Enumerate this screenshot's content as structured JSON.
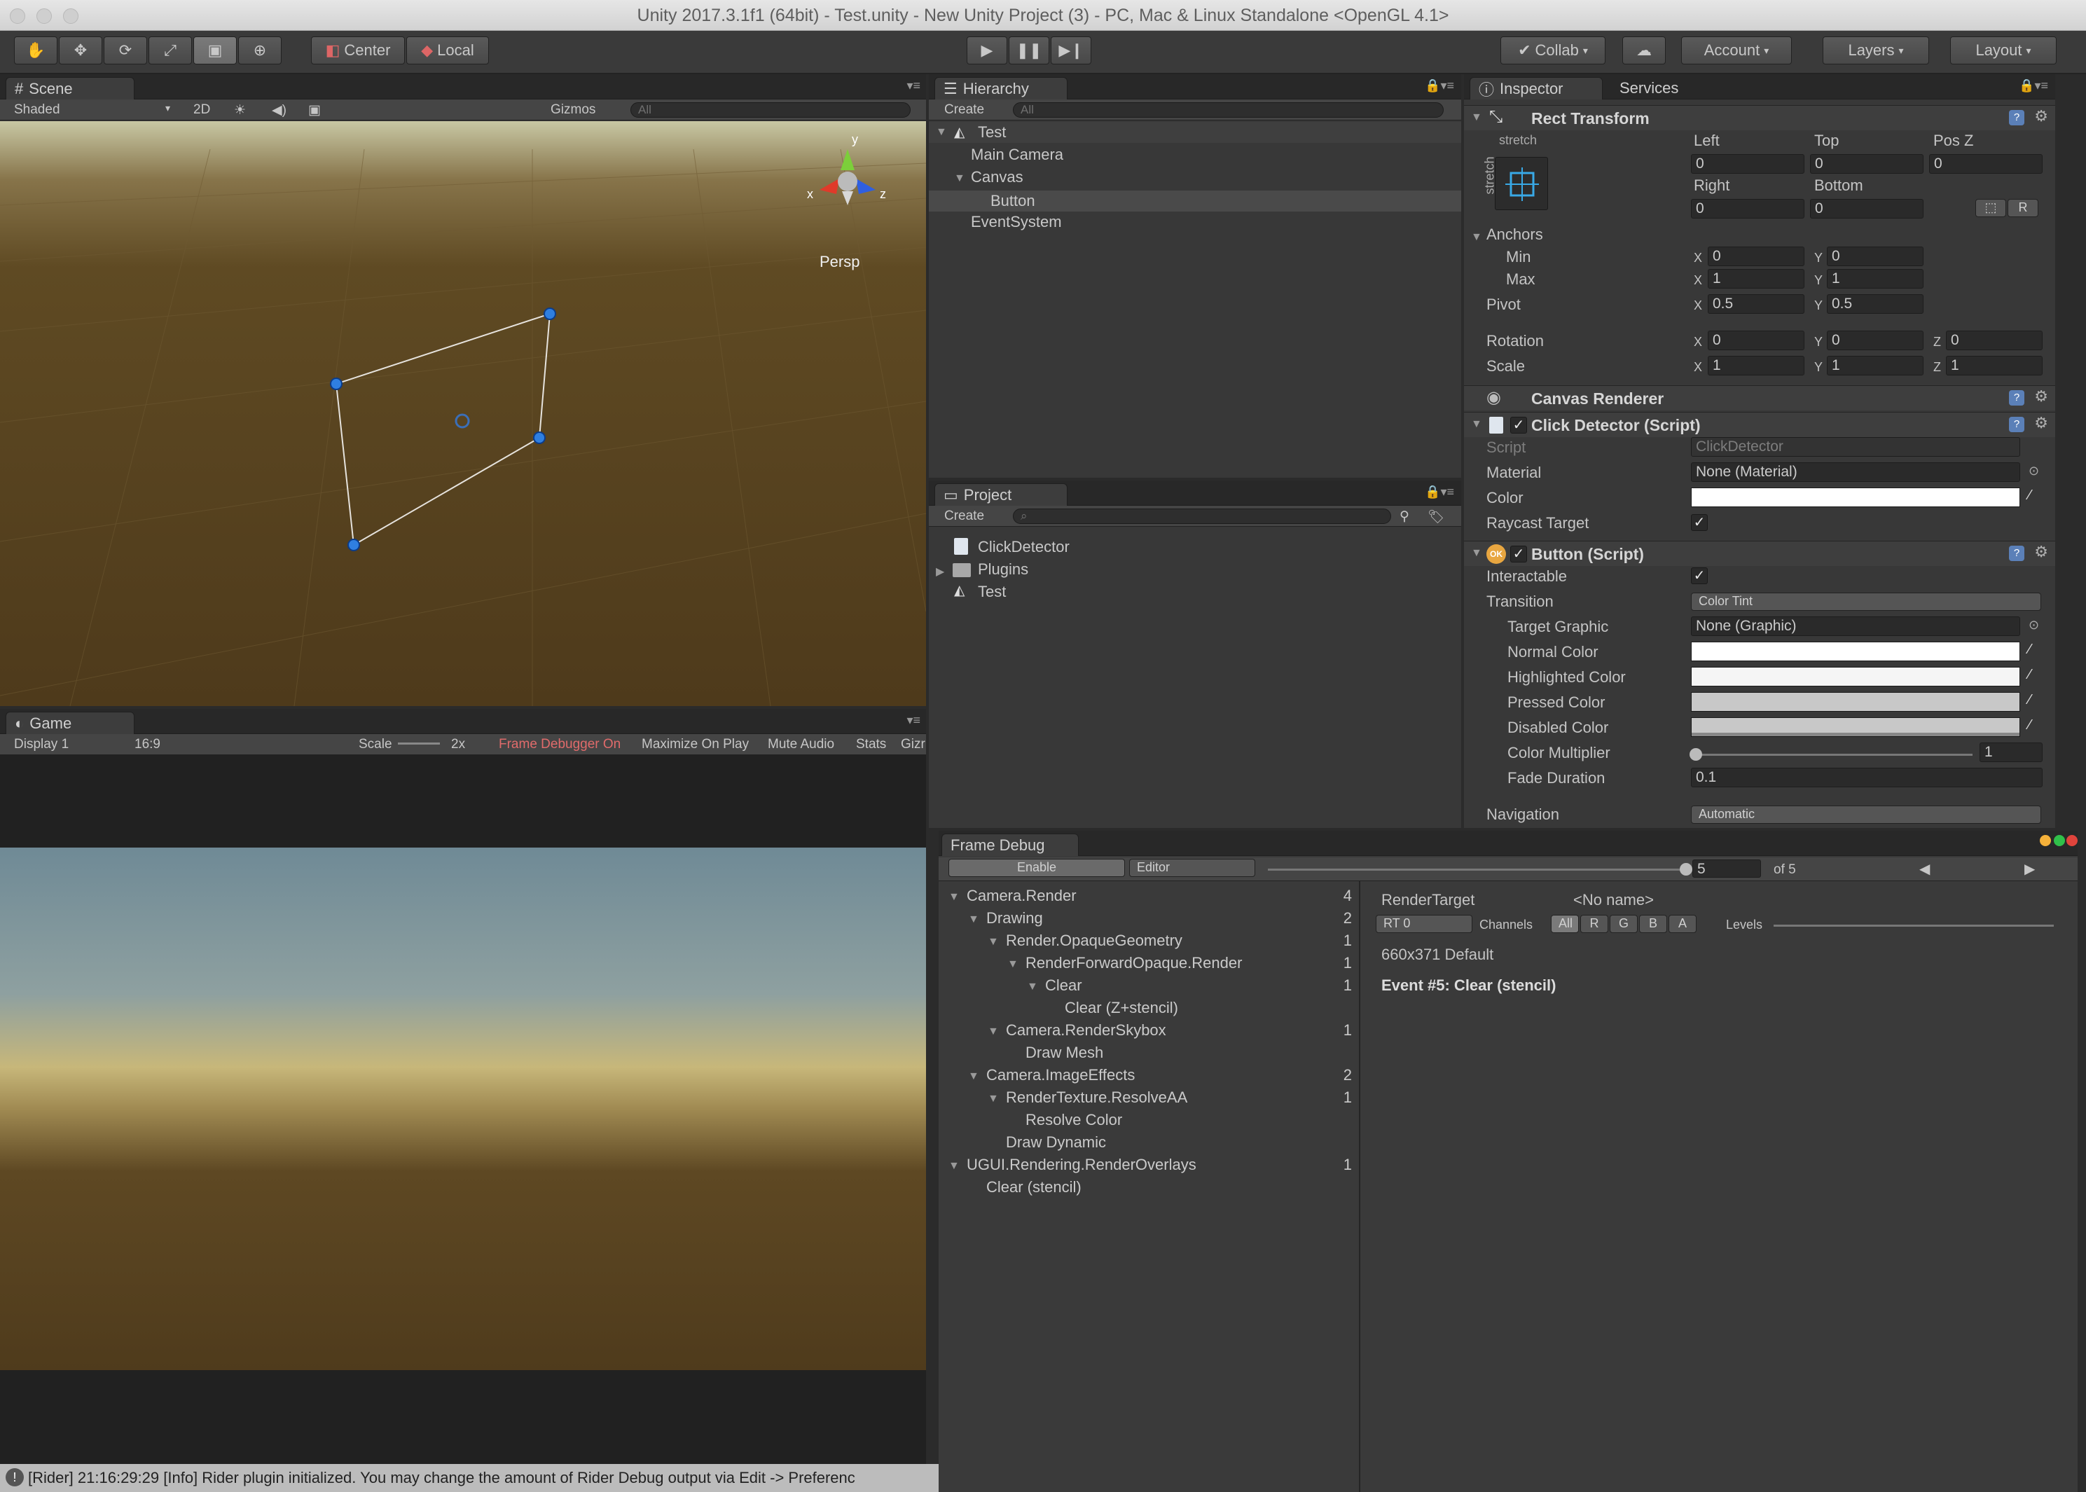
{
  "window": {
    "title": "Unity 2017.3.1f1 (64bit) - Test.unity - New Unity Project (3) - PC, Mac & Linux Standalone <OpenGL 4.1>"
  },
  "toolbar": {
    "pivot_mode": "Center",
    "pivot_rotation": "Local",
    "collab": "Collab",
    "account": "Account",
    "layers": "Layers",
    "layout": "Layout"
  },
  "scene": {
    "tab": "Scene",
    "shading": "Shaded",
    "mode2d": "2D",
    "gizmos": "Gizmos",
    "search_placeholder": "All",
    "axis_y": "y",
    "axis_x": "x",
    "axis_z": "z",
    "projection": "Persp"
  },
  "game": {
    "tab": "Game",
    "display": "Display 1",
    "aspect": "16:9",
    "scale_label": "Scale",
    "scale_value": "2x",
    "frame_debugger": "Frame Debugger On",
    "maximize": "Maximize On Play",
    "mute": "Mute Audio",
    "stats": "Stats",
    "gizmos": "Gizr"
  },
  "hierarchy": {
    "tab": "Hierarchy",
    "create": "Create",
    "search_placeholder": "All",
    "scene_name": "Test",
    "items": [
      {
        "label": "Main Camera"
      },
      {
        "label": "Canvas"
      },
      {
        "label": "Button"
      },
      {
        "label": "EventSystem"
      }
    ]
  },
  "project": {
    "tab": "Project",
    "create": "Create",
    "items": [
      {
        "label": "ClickDetector",
        "icon": "script-icon"
      },
      {
        "label": "Plugins",
        "icon": "folder-icon"
      },
      {
        "label": "Test",
        "icon": "unity-scene-icon"
      }
    ]
  },
  "inspector": {
    "tab": "Inspector",
    "tab2": "Services",
    "rect_transform": {
      "title": "Rect Transform",
      "anchor_preset": "stretch",
      "left_label": "Left",
      "top_label": "Top",
      "posz_label": "Pos Z",
      "left": "0",
      "top": "0",
      "posz": "0",
      "right_label": "Right",
      "bottom_label": "Bottom",
      "right": "0",
      "bottom": "0",
      "r_button": "R",
      "anchors_label": "Anchors",
      "min_label": "Min",
      "max_label": "Max",
      "min_x": "0",
      "min_y": "0",
      "max_x": "1",
      "max_y": "1",
      "pivot_label": "Pivot",
      "pivot_x": "0.5",
      "pivot_y": "0.5",
      "rotation_label": "Rotation",
      "rot_x": "0",
      "rot_y": "0",
      "rot_z": "0",
      "scale_label": "Scale",
      "scale_x": "1",
      "scale_y": "1",
      "scale_z": "1",
      "x": "X",
      "y": "Y",
      "z": "Z"
    },
    "canvas_renderer": {
      "title": "Canvas Renderer"
    },
    "click_detector": {
      "title": "Click Detector (Script)",
      "script_label": "Script",
      "script_value": "ClickDetector",
      "material_label": "Material",
      "material_value": "None (Material)",
      "color_label": "Color",
      "color_value": "#ffffff",
      "raycast_label": "Raycast Target"
    },
    "button_script": {
      "title": "Button (Script)",
      "badge": "OK",
      "interactable_label": "Interactable",
      "transition_label": "Transition",
      "transition_value": "Color Tint",
      "target_graphic_label": "Target Graphic",
      "target_graphic_value": "None (Graphic)",
      "normal_label": "Normal Color",
      "normal_color": "#ffffff",
      "highlighted_label": "Highlighted Color",
      "highlighted_color": "#f5f5f5",
      "pressed_label": "Pressed Color",
      "pressed_color": "#c8c8c8",
      "disabled_label": "Disabled Color",
      "disabled_color": "#c8c8c8",
      "multiplier_label": "Color Multiplier",
      "multiplier_value": "1",
      "fade_label": "Fade Duration",
      "fade_value": "0.1",
      "navigation_label": "Navigation",
      "navigation_value": "Automatic"
    }
  },
  "frame_debug": {
    "tab": "Frame Debug",
    "enable": "Enable",
    "target": "Editor",
    "event_index": "5",
    "of_total": "of 5",
    "render_target_label": "RenderTarget",
    "render_target_value": "<No name>",
    "rt": "RT 0",
    "channels_label": "Channels",
    "channels": [
      "All",
      "R",
      "G",
      "B",
      "A"
    ],
    "levels_label": "Levels",
    "resolution": "660x371 Default",
    "event_title": "Event #5: Clear (stencil)",
    "tree": [
      {
        "label": "Camera.Render",
        "count": "4",
        "depth": 0,
        "expanded": true
      },
      {
        "label": "Drawing",
        "count": "2",
        "depth": 1,
        "expanded": true
      },
      {
        "label": "Render.OpaqueGeometry",
        "count": "1",
        "depth": 2,
        "expanded": true
      },
      {
        "label": "RenderForwardOpaque.Render",
        "count": "1",
        "depth": 3,
        "expanded": true
      },
      {
        "label": "Clear",
        "count": "1",
        "depth": 4,
        "expanded": true
      },
      {
        "label": "Clear (Z+stencil)",
        "count": "",
        "depth": 5,
        "expanded": false
      },
      {
        "label": "Camera.RenderSkybox",
        "count": "1",
        "depth": 2,
        "expanded": true
      },
      {
        "label": "Draw Mesh",
        "count": "",
        "depth": 3,
        "expanded": false
      },
      {
        "label": "Camera.ImageEffects",
        "count": "2",
        "depth": 1,
        "expanded": true
      },
      {
        "label": "RenderTexture.ResolveAA",
        "count": "1",
        "depth": 2,
        "expanded": true
      },
      {
        "label": "Resolve Color",
        "count": "",
        "depth": 3,
        "expanded": false
      },
      {
        "label": "Draw Dynamic",
        "count": "",
        "depth": 2,
        "expanded": false
      },
      {
        "label": "UGUI.Rendering.RenderOverlays",
        "count": "1",
        "depth": 0,
        "expanded": true
      },
      {
        "label": "Clear (stencil)",
        "count": "",
        "depth": 1,
        "expanded": false
      }
    ]
  },
  "status": {
    "message": "[Rider] 21:16:29:29 [Info] Rider plugin initialized. You may change the amount of Rider Debug output via Edit -> Preferenc"
  }
}
